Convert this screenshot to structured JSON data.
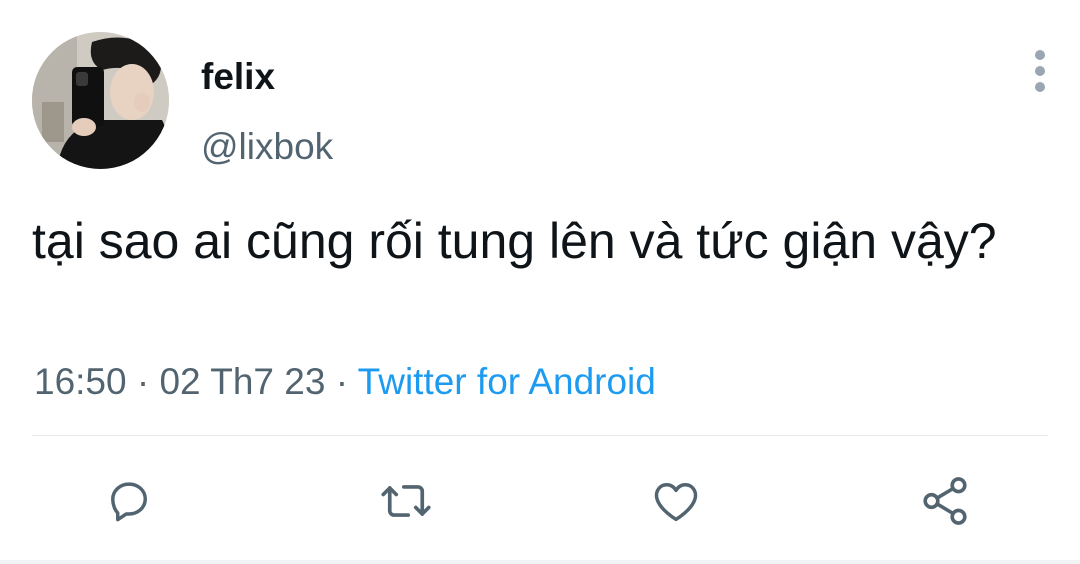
{
  "tweet": {
    "author": {
      "display_name": "felix",
      "handle": "@lixbok"
    },
    "text": "tại sao ai cũng rối tung lên và tức giận vậy?",
    "timestamp": {
      "time": "16:50",
      "date": "02 Th7 23",
      "separator": " · ",
      "source": "Twitter for Android"
    }
  },
  "actions": [
    {
      "name": "reply",
      "icon": "reply-icon"
    },
    {
      "name": "retweet",
      "icon": "retweet-icon"
    },
    {
      "name": "like",
      "icon": "heart-icon"
    },
    {
      "name": "share",
      "icon": "share-icon"
    }
  ],
  "colors": {
    "text_primary": "#0f1419",
    "text_secondary": "#536471",
    "link": "#1d9bf0",
    "icon": "#536471",
    "divider": "#e6e9ec"
  }
}
